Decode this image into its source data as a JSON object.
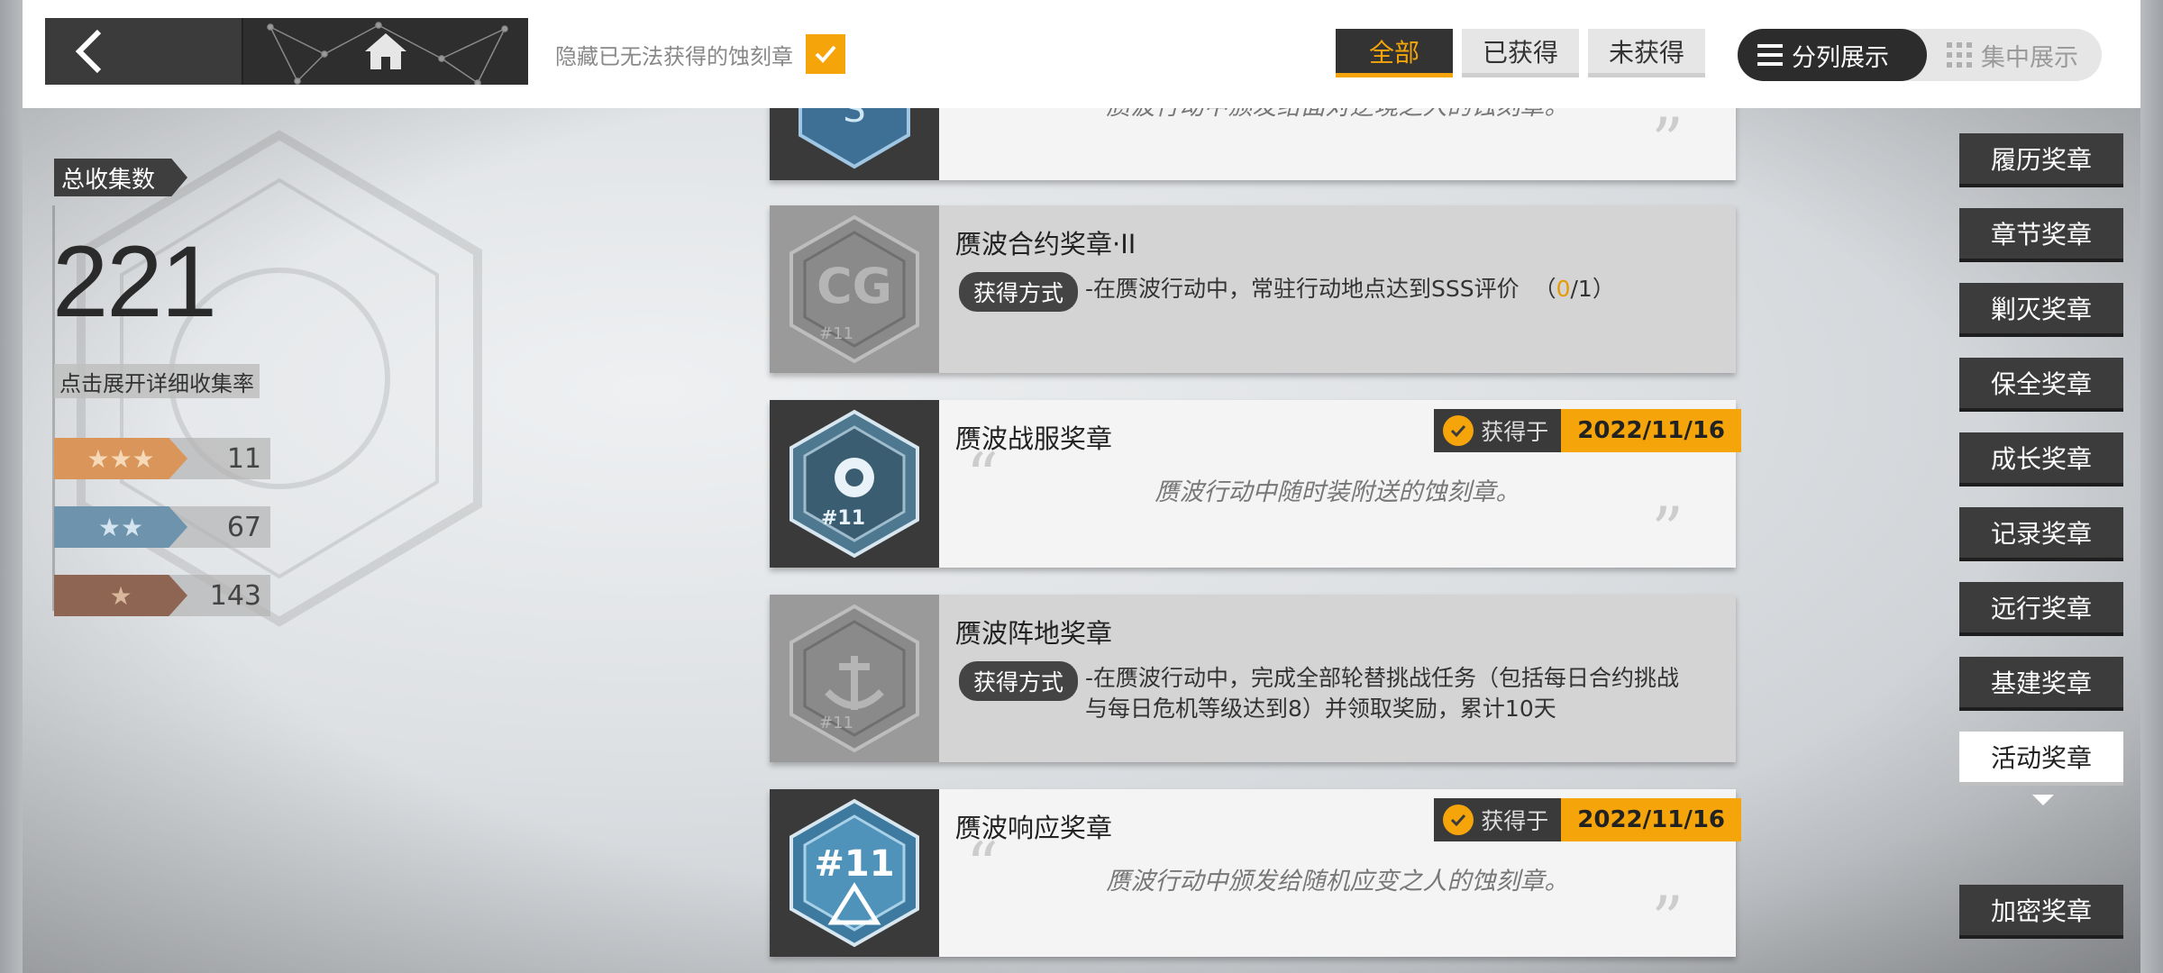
{
  "topbar": {
    "hide_unobtainable_label": "隐藏已无法获得的蚀刻章",
    "hide_unobtainable_checked": true,
    "filters": [
      {
        "label": "全部",
        "active": true
      },
      {
        "label": "已获得",
        "active": false
      },
      {
        "label": "未获得",
        "active": false
      }
    ],
    "view_modes": [
      {
        "label": "分列展示",
        "active": true,
        "icon": "list-icon"
      },
      {
        "label": "集中展示",
        "active": false,
        "icon": "grid-icon"
      }
    ]
  },
  "stats": {
    "total_label": "总收集数",
    "total_value": "221",
    "detail_button": "点击展开详细收集率",
    "tiers": [
      {
        "stars": "★★★",
        "count": "11",
        "color": "#d9955a"
      },
      {
        "stars": "★★",
        "count": "67",
        "color": "#6d93ad"
      },
      {
        "stars": "★",
        "count": "143",
        "color": "#8d6552"
      }
    ]
  },
  "medals": [
    {
      "title": "",
      "state": "obtained",
      "desc": "赝波行动中颁发给面对逆境之人的蚀刻章。",
      "partial": true
    },
    {
      "title": "赝波合约奖章·II",
      "state": "locked",
      "method_label": "获得方式",
      "method_text": "-在赝波行动中，常驻行动地点达到SSS评价",
      "progress_open": "（",
      "progress_current": "0",
      "progress_sep": "/",
      "progress_total": "1",
      "progress_close": "）"
    },
    {
      "title": "赝波战服奖章",
      "state": "obtained",
      "obtained_label": "获得于",
      "date": "2022/11/16",
      "desc": "赝波行动中随时装附送的蚀刻章。"
    },
    {
      "title": "赝波阵地奖章",
      "state": "locked",
      "method_label": "获得方式",
      "method_text": "-在赝波行动中，完成全部轮替挑战任务（包括每日合约挑战与每日危机等级达到8）并领取奖励，累计10天"
    },
    {
      "title": "赝波响应奖章",
      "state": "obtained",
      "obtained_label": "获得于",
      "date": "2022/11/16",
      "desc": "赝波行动中颁发给随机应变之人的蚀刻章。"
    }
  ],
  "categories": [
    {
      "label": "履历奖章",
      "active": false
    },
    {
      "label": "章节奖章",
      "active": false
    },
    {
      "label": "剿灭奖章",
      "active": false
    },
    {
      "label": "保全奖章",
      "active": false
    },
    {
      "label": "成长奖章",
      "active": false
    },
    {
      "label": "记录奖章",
      "active": false
    },
    {
      "label": "远行奖章",
      "active": false
    },
    {
      "label": "基建奖章",
      "active": false
    },
    {
      "label": "活动奖章",
      "active": true
    },
    {
      "label": "加密奖章",
      "active": false
    }
  ],
  "colors": {
    "accent": "#f5a50a",
    "dark": "#3a3a3a"
  }
}
